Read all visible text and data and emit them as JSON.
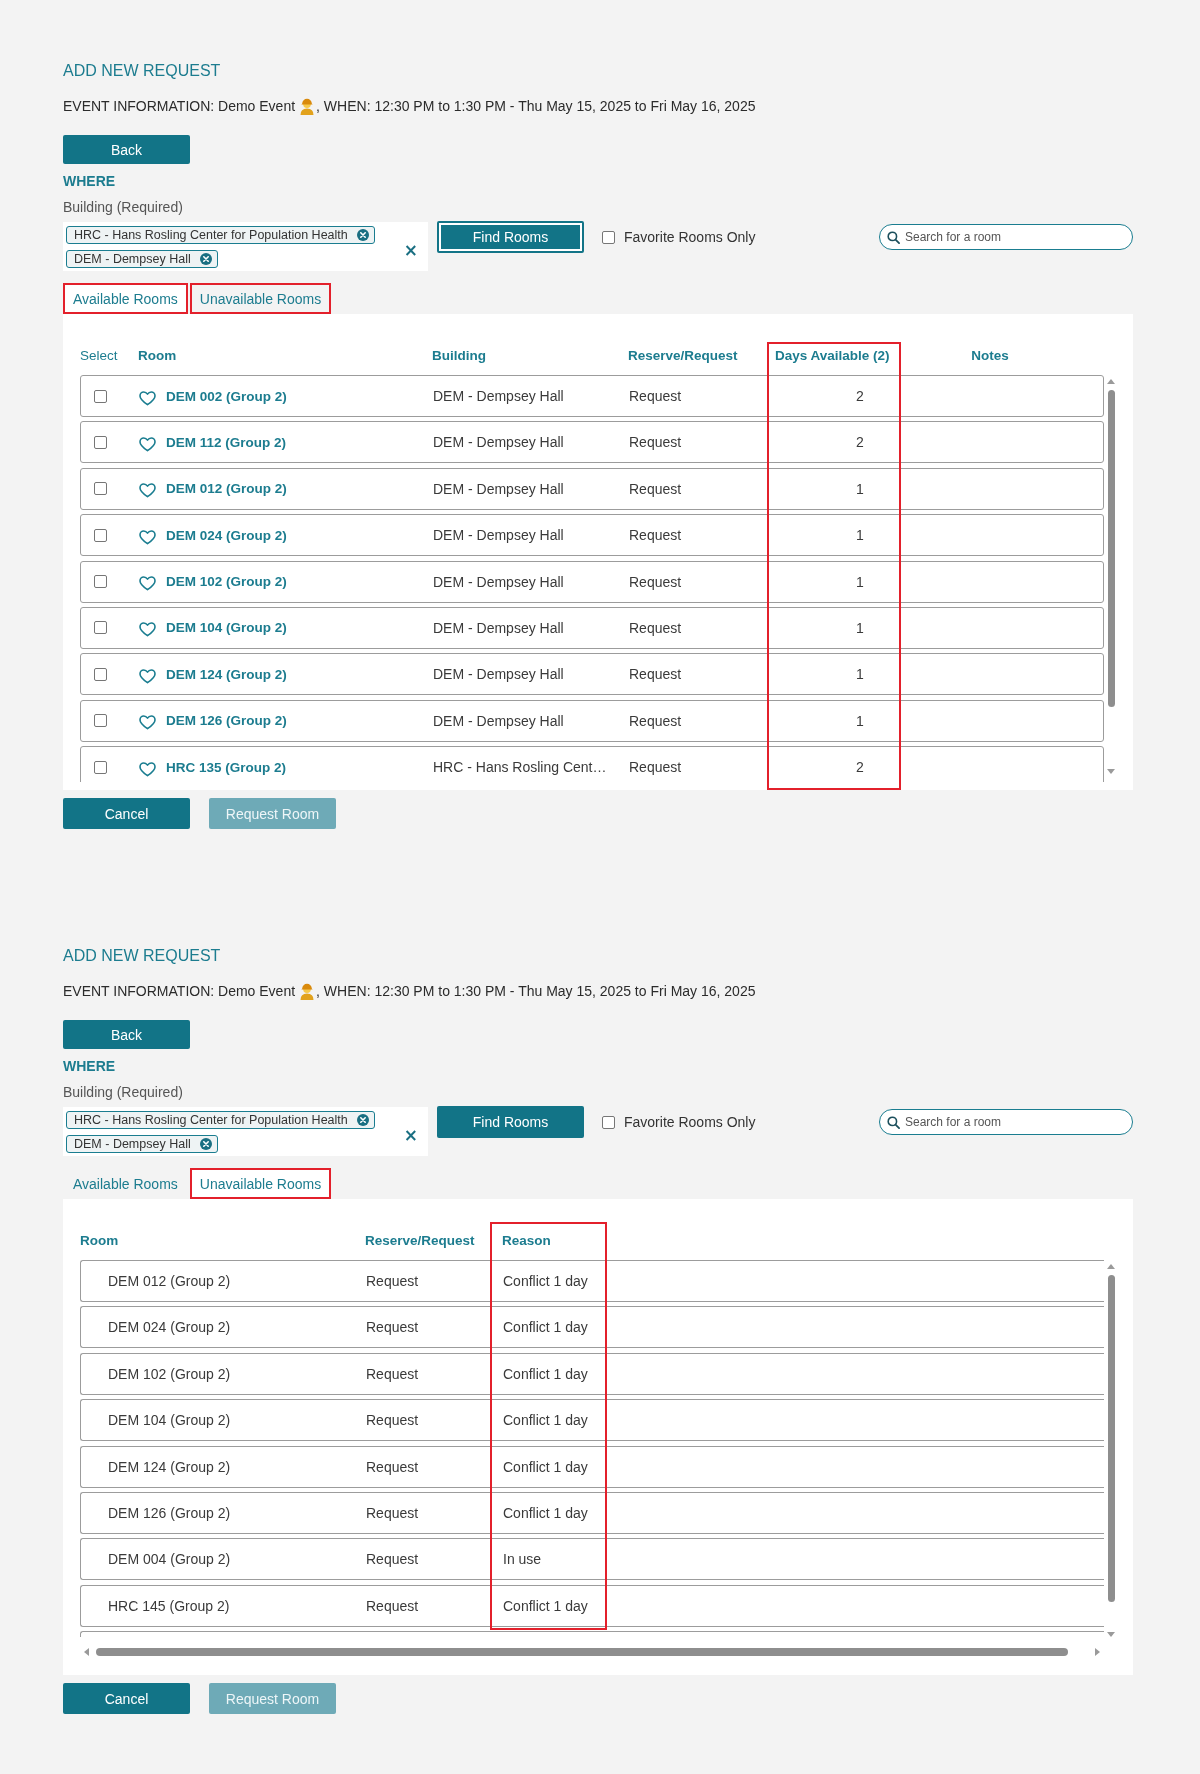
{
  "panels": [
    {
      "title": "ADD NEW REQUEST",
      "event_info": {
        "text": "EVENT INFORMATION: Demo Event",
        "text_after_icon": ", WHEN: 12:30 PM to 1:30 PM - Thu May 15, 2025 to Fri May 16, 2025"
      },
      "back_button": "Back",
      "where_label": "WHERE",
      "building_label": "Building (Required)",
      "building_chips": [
        {
          "label": "HRC - Hans Rosling Center for Population Health"
        },
        {
          "label": "DEM - Dempsey Hall"
        }
      ],
      "clear_button": "×",
      "find_button": {
        "label": "Find Rooms",
        "focused": true
      },
      "favorite_filter": {
        "label": "Favorite Rooms Only",
        "checked": false
      },
      "search": {
        "placeholder": "Search for a room"
      },
      "tabs": [
        {
          "label": "Available Rooms",
          "selected": true,
          "highlighted": true
        },
        {
          "label": "Unavailable Rooms",
          "selected": false,
          "highlighted": true
        }
      ],
      "table": {
        "kind": "available",
        "columns": [
          {
            "kind": "select",
            "label": "Select",
            "highlighted": false
          },
          {
            "kind": "room",
            "label": "Room",
            "highlighted": false
          },
          {
            "kind": "building",
            "label": "Building",
            "highlighted": false
          },
          {
            "kind": "reserve",
            "label": "Reserve/Request",
            "highlighted": false
          },
          {
            "kind": "days",
            "label": "Days Available (2)",
            "highlighted": true
          },
          {
            "kind": "notes",
            "label": "Notes",
            "highlighted": false
          }
        ],
        "rows": [
          {
            "checked": false,
            "favorite": false,
            "room": "DEM 002 (Group 2)",
            "building": "DEM - Dempsey Hall",
            "reserve": "Request",
            "days": "2"
          },
          {
            "checked": false,
            "favorite": false,
            "room": "DEM 112 (Group 2)",
            "building": "DEM - Dempsey Hall",
            "reserve": "Request",
            "days": "2"
          },
          {
            "checked": false,
            "favorite": false,
            "room": "DEM 012 (Group 2)",
            "building": "DEM - Dempsey Hall",
            "reserve": "Request",
            "days": "1"
          },
          {
            "checked": false,
            "favorite": false,
            "room": "DEM 024 (Group 2)",
            "building": "DEM - Dempsey Hall",
            "reserve": "Request",
            "days": "1"
          },
          {
            "checked": false,
            "favorite": false,
            "room": "DEM 102 (Group 2)",
            "building": "DEM - Dempsey Hall",
            "reserve": "Request",
            "days": "1"
          },
          {
            "checked": false,
            "favorite": false,
            "room": "DEM 104 (Group 2)",
            "building": "DEM - Dempsey Hall",
            "reserve": "Request",
            "days": "1"
          },
          {
            "checked": false,
            "favorite": false,
            "room": "DEM 124 (Group 2)",
            "building": "DEM - Dempsey Hall",
            "reserve": "Request",
            "days": "1"
          },
          {
            "checked": false,
            "favorite": false,
            "room": "DEM 126 (Group 2)",
            "building": "DEM - Dempsey Hall",
            "reserve": "Request",
            "days": "1"
          },
          {
            "checked": false,
            "favorite": false,
            "room": "HRC 135 (Group 2)",
            "building": "HRC - Hans Rosling Cent…",
            "reserve": "Request",
            "days": "2"
          }
        ]
      },
      "footer_buttons": [
        {
          "label": "Cancel",
          "disabled": false
        },
        {
          "label": "Request Room",
          "disabled": true
        }
      ]
    },
    {
      "title": "ADD NEW REQUEST",
      "event_info": {
        "text": "EVENT INFORMATION: Demo Event",
        "text_after_icon": ", WHEN: 12:30 PM to 1:30 PM - Thu May 15, 2025 to Fri May 16, 2025"
      },
      "back_button": "Back",
      "where_label": "WHERE",
      "building_label": "Building (Required)",
      "building_chips": [
        {
          "label": "HRC - Hans Rosling Center for Population Health"
        },
        {
          "label": "DEM - Dempsey Hall"
        }
      ],
      "clear_button": "×",
      "find_button": {
        "label": "Find Rooms",
        "focused": false
      },
      "favorite_filter": {
        "label": "Favorite Rooms Only",
        "checked": false
      },
      "search": {
        "placeholder": "Search for a room"
      },
      "tabs": [
        {
          "label": "Available Rooms",
          "selected": false,
          "highlighted": false
        },
        {
          "label": "Unavailable Rooms",
          "selected": true,
          "highlighted": true
        }
      ],
      "table": {
        "kind": "unavailable",
        "columns": [
          {
            "kind": "room",
            "label": "Room",
            "highlighted": false
          },
          {
            "kind": "reserve",
            "label": "Reserve/Request",
            "highlighted": false
          },
          {
            "kind": "reason",
            "label": "Reason",
            "highlighted": true
          }
        ],
        "rows": [
          {
            "room": "DEM 012 (Group 2)",
            "reserve": "Request",
            "reason": "Conflict 1 day"
          },
          {
            "room": "DEM 024 (Group 2)",
            "reserve": "Request",
            "reason": "Conflict 1 day"
          },
          {
            "room": "DEM 102 (Group 2)",
            "reserve": "Request",
            "reason": "Conflict 1 day"
          },
          {
            "room": "DEM 104 (Group 2)",
            "reserve": "Request",
            "reason": "Conflict 1 day"
          },
          {
            "room": "DEM 124 (Group 2)",
            "reserve": "Request",
            "reason": "Conflict 1 day"
          },
          {
            "room": "DEM 126 (Group 2)",
            "reserve": "Request",
            "reason": "Conflict 1 day"
          },
          {
            "room": "DEM 004 (Group 2)",
            "reserve": "Request",
            "reason": "In use"
          },
          {
            "room": "HRC 145 (Group 2)",
            "reserve": "Request",
            "reason": "Conflict 1 day"
          }
        ]
      },
      "footer_buttons": [
        {
          "label": "Cancel",
          "disabled": false
        },
        {
          "label": "Request Room",
          "disabled": true
        }
      ]
    }
  ]
}
